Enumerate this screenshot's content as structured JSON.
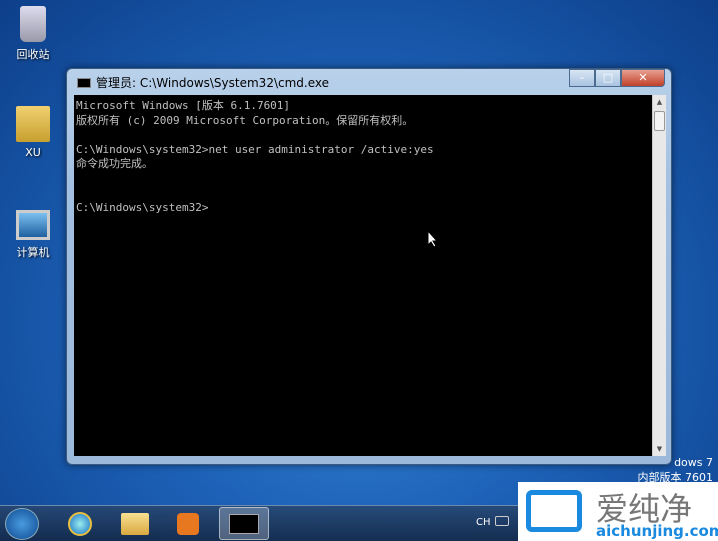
{
  "desktop": {
    "icons": [
      {
        "label": "回收站",
        "icon": "recycle-bin-icon"
      },
      {
        "label": "XU",
        "icon": "user-folder-icon"
      },
      {
        "label": "计算机",
        "icon": "computer-icon"
      }
    ]
  },
  "window": {
    "title": "管理员: C:\\Windows\\System32\\cmd.exe",
    "lines": [
      "Microsoft Windows [版本 6.1.7601]",
      "版权所有 (c) 2009 Microsoft Corporation。保留所有权利。",
      "",
      "C:\\Windows\\system32>net user administrator /active:yes",
      "命令成功完成。",
      "",
      "",
      "C:\\Windows\\system32>"
    ]
  },
  "branding": {
    "line1": "dows 7",
    "line2": "内部版本 7601"
  },
  "taskbar": {
    "lang": "CH",
    "buttons": [
      "internet-explorer-icon",
      "explorer-folder-icon",
      "media-player-icon",
      "cmd-icon"
    ]
  },
  "watermark": {
    "name": "爱纯净",
    "url": "aichunjing.com"
  }
}
